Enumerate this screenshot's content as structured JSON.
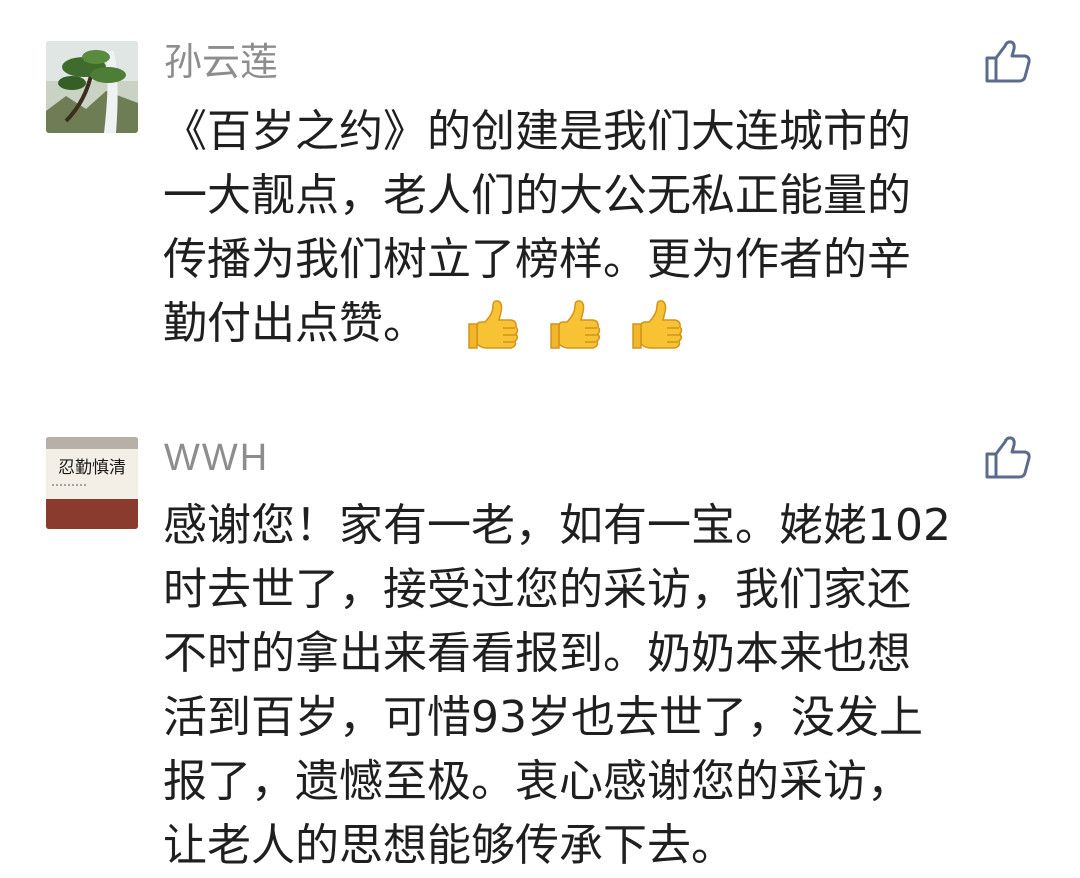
{
  "comments": [
    {
      "author": "孙云莲",
      "lines": [
        "《百岁之约》的创建是我们大连城市的",
        "一大靓点，老人们的大公无私正能量的",
        "传播为我们树立了榜样。更为作者的辛",
        "勤付出点赞。"
      ],
      "emojis": [
        "thumbs-up-emoji",
        "thumbs-up-emoji",
        "thumbs-up-emoji"
      ],
      "avatar_icon": "tree-landscape-avatar",
      "like_icon": "thumbs-up-outline-icon"
    },
    {
      "author": "WWH",
      "lines": [
        "感谢您！家有一老，如有一宝。姥姥102",
        "时去世了，接受过您的采访，我们家还",
        "不时的拿出来看看报到。奶奶本来也想",
        "活到百岁，可惜93岁也去世了，没发上",
        "报了，遗憾至极。衷心感谢您的采访，",
        "让老人的思想能够传承下去。"
      ],
      "avatar_icon": "calligraphy-plaque-avatar",
      "avatar_text": "忍勤慎清",
      "like_icon": "thumbs-up-outline-icon"
    }
  ],
  "colors": {
    "author": "#8d8d8d",
    "body_text": "#1f1f1f",
    "like_icon": "#5b6b8c",
    "emoji_yellow": "#f7c234"
  }
}
